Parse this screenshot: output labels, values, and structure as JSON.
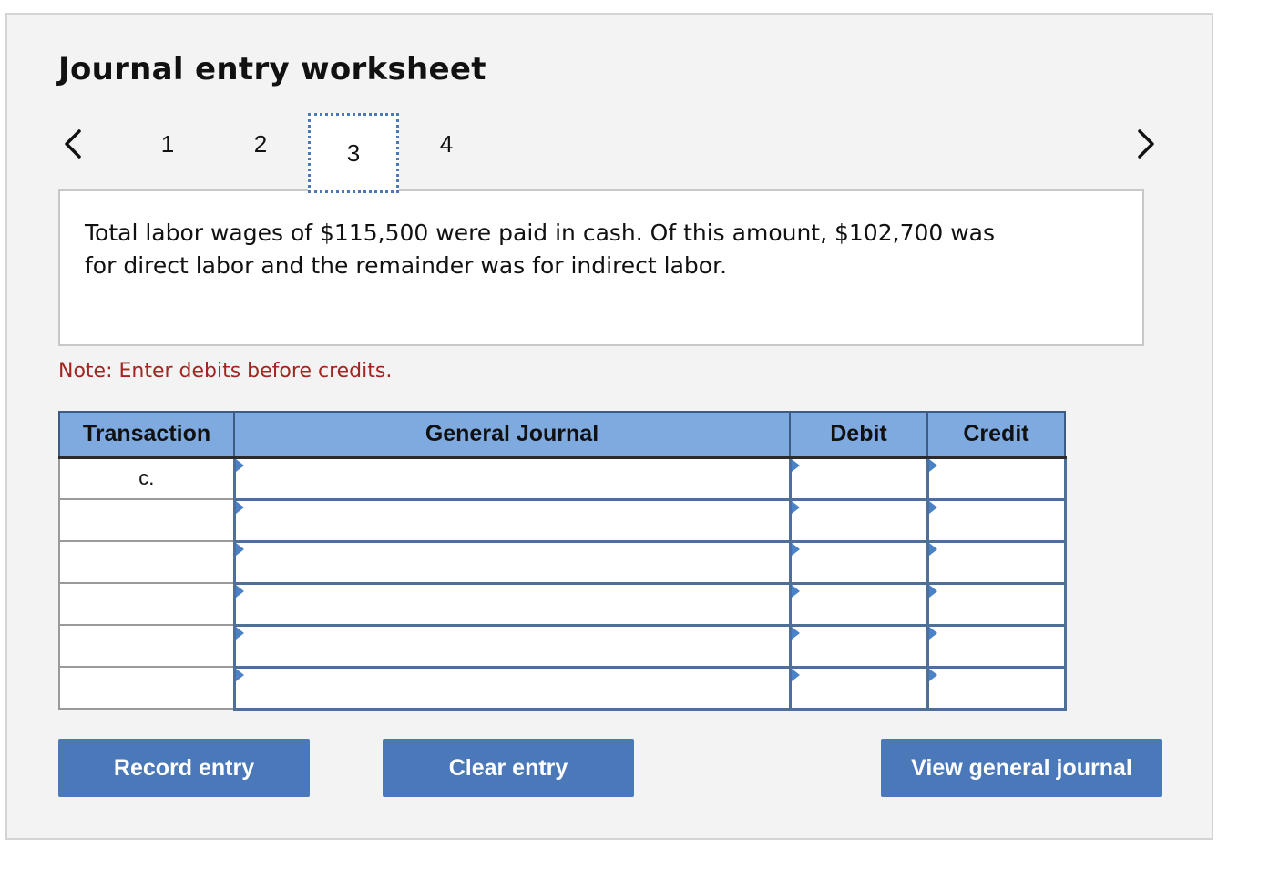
{
  "worksheet": {
    "title": "Journal entry worksheet",
    "pager": {
      "prev_icon": "chevron-left-icon",
      "next_icon": "chevron-right-icon",
      "pages": [
        "1",
        "2",
        "3",
        "4"
      ],
      "active_page": "3"
    },
    "description": "Total labor wages of $115,500 were paid in cash. Of this amount, $102,700 was for direct labor and the remainder was for indirect labor.",
    "note": "Note: Enter debits before credits.",
    "table": {
      "headers": {
        "transaction": "Transaction",
        "general_journal": "General Journal",
        "debit": "Debit",
        "credit": "Credit"
      },
      "rows": [
        {
          "transaction": "c.",
          "account": "",
          "debit": "",
          "credit": ""
        },
        {
          "transaction": "",
          "account": "",
          "debit": "",
          "credit": ""
        },
        {
          "transaction": "",
          "account": "",
          "debit": "",
          "credit": ""
        },
        {
          "transaction": "",
          "account": "",
          "debit": "",
          "credit": ""
        },
        {
          "transaction": "",
          "account": "",
          "debit": "",
          "credit": ""
        },
        {
          "transaction": "",
          "account": "",
          "debit": "",
          "credit": ""
        }
      ]
    },
    "buttons": {
      "record": "Record entry",
      "clear": "Clear entry",
      "view": "View general journal"
    },
    "colors": {
      "panel_bg": "#f3f3f3",
      "header_bg": "#7faadf",
      "button_bg": "#4a78b8",
      "note_text": "#a32521",
      "active_page_border": "#4a78b8"
    }
  }
}
